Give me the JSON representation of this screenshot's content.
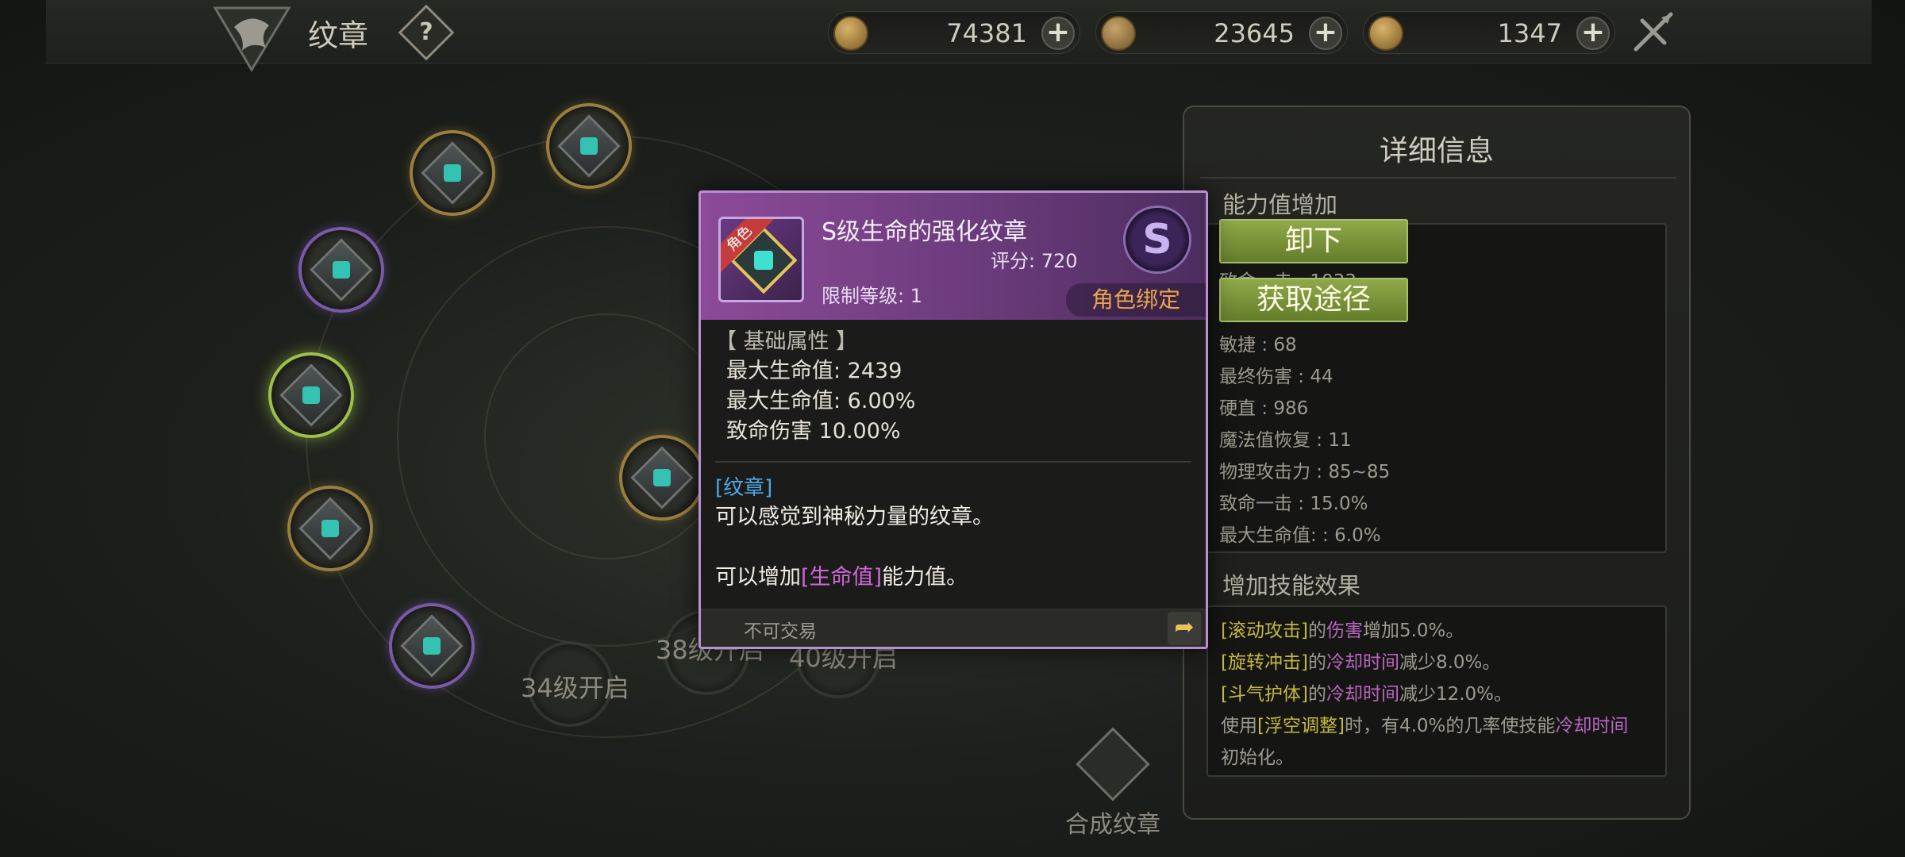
{
  "header": {
    "title": "纹章",
    "help_label": "?",
    "currencies": [
      {
        "icon": "gold-swirl-coin-icon",
        "value": "74381",
        "plus": "+"
      },
      {
        "icon": "bronze-lock-coin-icon",
        "value": "23645",
        "plus": "+"
      },
      {
        "icon": "gold-coin-icon",
        "value": "1347",
        "plus": "+"
      }
    ]
  },
  "orbit": {
    "locks": [
      "34级开启",
      "38级开启",
      "40级开启"
    ],
    "synth_label": "合成纹章"
  },
  "tooltip": {
    "badge": "角色",
    "name": "S级生命的强化纹章",
    "score": "评分: 720",
    "level": "限制等级: 1",
    "grade": "S",
    "bind": "角色绑定",
    "section_base": "【 基础属性 】",
    "stats": [
      "最大生命值:   2439",
      "最大生命值:   6.00%",
      "致命伤害 10.00%"
    ],
    "tag": "[纹章]",
    "desc1": "可以感觉到神秘力量的纹章。",
    "desc2_pre": "可以增加",
    "desc2_hl": "[生命值]",
    "desc2_post": "能力值。",
    "trade": "不可交易",
    "share": "➦"
  },
  "panel": {
    "title": "详细信息",
    "sub_stats": "能力值增加",
    "stats": [
      "致命一击 : 1033",
      "敏捷 : 68",
      "最终伤害 : 44",
      "硬直 : 986",
      "魔法值恢复 : 11",
      "物理攻击力 : 85~85",
      "致命一击 : 15.0%",
      "最大生命值:   : 6.0%"
    ],
    "sub_skills": "增加技能效果",
    "skills": [
      {
        "a": "[滚动攻击]",
        "b": "的",
        "c": "伤害",
        "d": "增加5.0%。"
      },
      {
        "a": "[旋转冲击]",
        "b": "的",
        "c": "冷却时间",
        "d": "减少8.0%。"
      },
      {
        "a": "[斗气护体]",
        "b": "的",
        "c": "冷却时间",
        "d": "减少12.0%。"
      }
    ],
    "skill4_pre": "使用",
    "skill4_g": "[浮空调整]",
    "skill4_mid": "时，有4.0%的几率使技能",
    "skill4_p": "冷却时间",
    "skill4_post": "初始化。",
    "btn_unequip": "卸下",
    "btn_obtain": "获取途径"
  }
}
